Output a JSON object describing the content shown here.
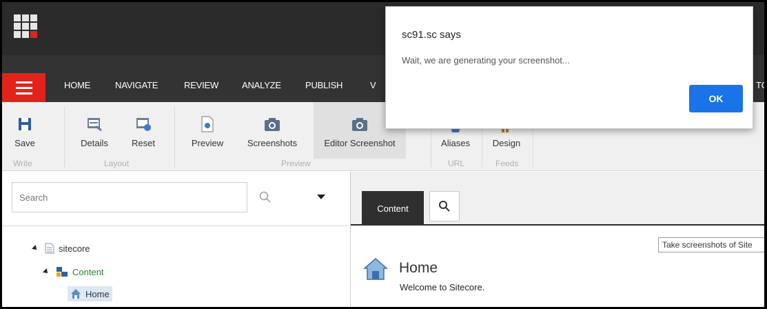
{
  "colors": {
    "accent_red": "#e2231a",
    "topbar": "#2b2b2b",
    "tabbar": "#333333",
    "ribbon_bg": "#f0f0f0",
    "ok_button": "#1a73e8"
  },
  "ribbon_tabs": [
    {
      "label": "HOME"
    },
    {
      "label": "NAVIGATE"
    },
    {
      "label": "REVIEW"
    },
    {
      "label": "ANALYZE"
    },
    {
      "label": "PUBLISH"
    },
    {
      "label": "V"
    }
  ],
  "ribbon_tab_tail": "TO",
  "ribbon": {
    "buttons": [
      {
        "label": "Save",
        "icon": "save-icon"
      },
      {
        "label": "Details",
        "icon": "details-icon"
      },
      {
        "label": "Reset",
        "icon": "reset-icon"
      },
      {
        "label": "Preview",
        "icon": "preview-icon"
      },
      {
        "label": "Screenshots",
        "icon": "camera-icon"
      },
      {
        "label": "Editor Screenshot",
        "icon": "camera-icon"
      },
      {
        "label": "Aliases",
        "icon": "aliases-icon"
      },
      {
        "label": "Design",
        "icon": "design-icon"
      }
    ],
    "groups": [
      {
        "label": "Write"
      },
      {
        "label": "Layout"
      },
      {
        "label": "Preview"
      },
      {
        "label": "URL"
      },
      {
        "label": "Feeds"
      }
    ]
  },
  "search": {
    "placeholder": "Search"
  },
  "tree": [
    {
      "label": "sitecore",
      "icon": "document-icon"
    },
    {
      "label": "Content",
      "icon": "content-tree-icon"
    },
    {
      "label": "Home",
      "icon": "home-icon"
    }
  ],
  "content_tabs": {
    "content_label": "Content"
  },
  "tooltip": "Take screenshots of Site",
  "item": {
    "title": "Home",
    "description": "Welcome to Sitecore."
  },
  "dialog": {
    "title": "sc91.sc says",
    "message": "Wait, we are generating your screenshot...",
    "ok_label": "OK"
  }
}
